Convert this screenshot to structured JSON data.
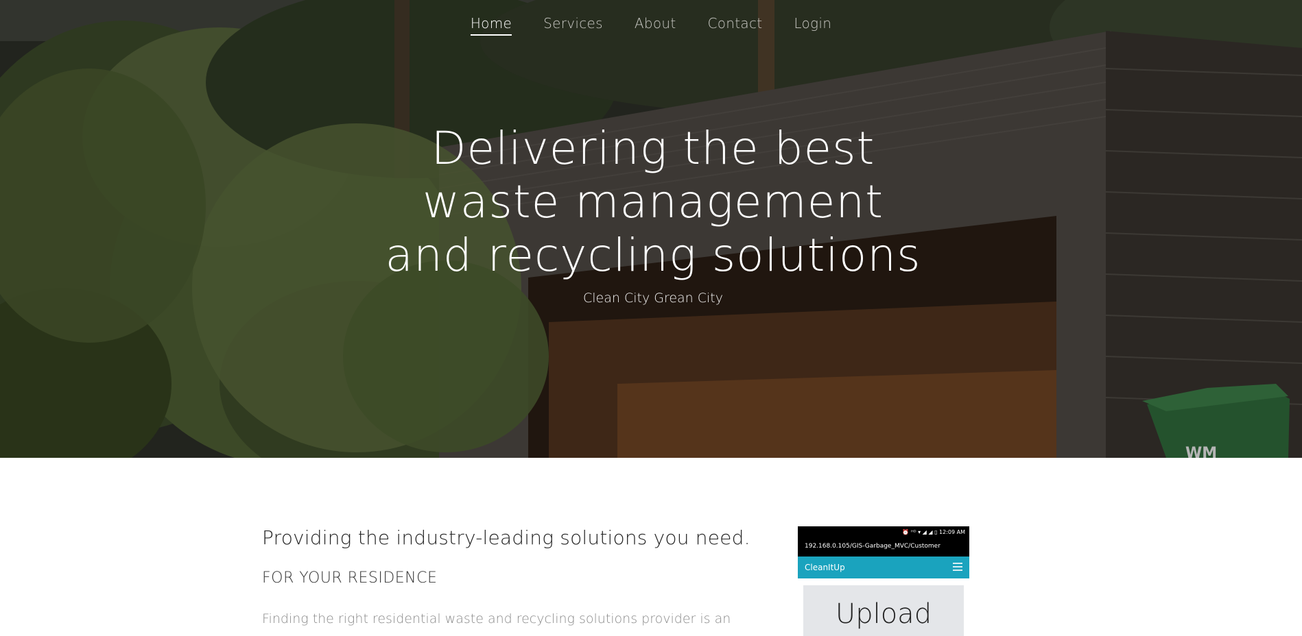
{
  "nav": {
    "items": [
      {
        "label": "Home",
        "active": true
      },
      {
        "label": "Services",
        "active": false
      },
      {
        "label": "About",
        "active": false
      },
      {
        "label": "Contact",
        "active": false
      },
      {
        "label": "Login",
        "active": false
      }
    ]
  },
  "hero": {
    "title_lines": [
      "Delivering the best",
      "waste management",
      "and recycling solutions"
    ],
    "subtitle": "Clean City Grean City"
  },
  "section": {
    "heading": "Providing the industry-leading solutions you need.",
    "subheading": "FOR YOUR RESIDENCE",
    "paragraph": "Finding the right residential waste and recycling solutions provider is an"
  },
  "phone": {
    "status": "⏰ ᴴᴰ ▾ ◢ ◢ ▯ 12:09 AM",
    "url": "192.168.0.105/GIS-Garbage_MVC/Customer",
    "app_name": "CleanItUp",
    "upload_label": "Upload",
    "app_color": "#1aa3be"
  },
  "bin_logo": "WM"
}
